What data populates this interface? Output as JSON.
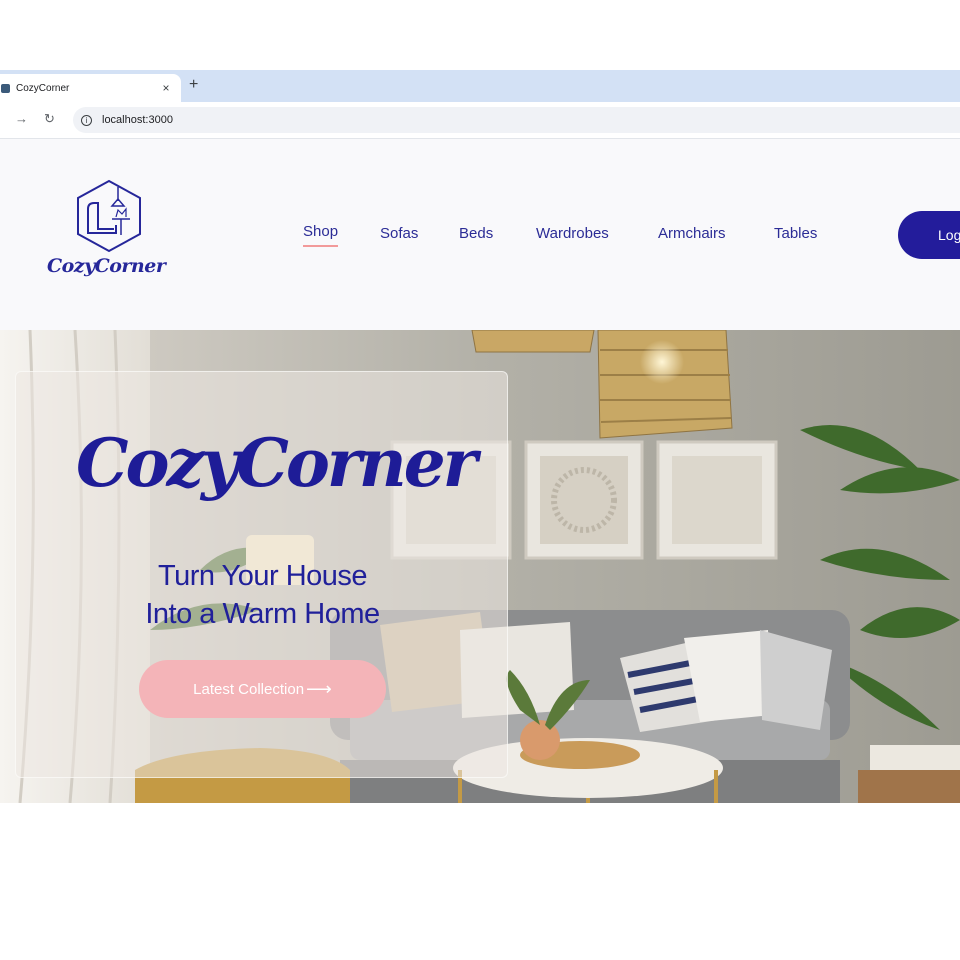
{
  "browser": {
    "tab_title": "CozyCorner",
    "tab_close": "×",
    "new_tab": "+",
    "url": "localhost:3000",
    "icons": [
      "favicon",
      "close-icon",
      "plus-icon",
      "forward-icon",
      "reload-icon",
      "info-icon"
    ]
  },
  "site": {
    "logo_text": "CozyCorner",
    "nav": [
      {
        "label": "Shop",
        "active": true
      },
      {
        "label": "Sofas",
        "active": false
      },
      {
        "label": "Beds",
        "active": false
      },
      {
        "label": "Wardrobes",
        "active": false
      },
      {
        "label": "Armchairs",
        "active": false
      },
      {
        "label": "Tables",
        "active": false
      }
    ],
    "login_label": "Log",
    "colors": {
      "brand": "#231c9b",
      "accent": "#f4b4b8",
      "underline": "#f29a9a"
    }
  },
  "hero": {
    "title": "CozyCorner",
    "tagline_line1": "Turn Your House",
    "tagline_line2": "Into a Warm Home",
    "cta_label": "Latest Collection",
    "cta_arrow": "⟶"
  }
}
